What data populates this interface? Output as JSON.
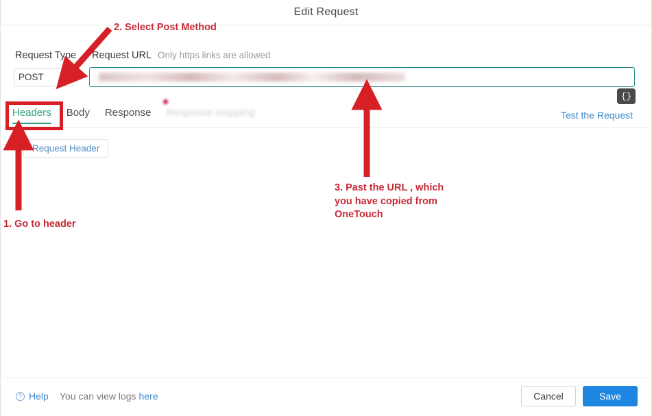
{
  "window": {
    "title": "Edit Request"
  },
  "form": {
    "request_type_label": "Request Type",
    "request_url_label": "Request URL",
    "https_hint": "Only https links are allowed",
    "request_type_value": "POST",
    "request_type_options": [
      "POST"
    ],
    "url_value": "",
    "url_placeholder": "",
    "url_redacted": true,
    "json_badge_label": "{}"
  },
  "tabs": [
    {
      "label": "Headers",
      "state": "active"
    },
    {
      "label": "Body",
      "state": "normal"
    },
    {
      "label": "Response",
      "state": "normal"
    },
    {
      "label": "Response mapping",
      "state": "disabled",
      "badge_dot": true
    }
  ],
  "actions": {
    "test_request_label": "Test the Request",
    "request_header_label": "Request Header"
  },
  "footer": {
    "help_icon": "question-circle-icon",
    "help_label": "Help",
    "logs_text_before": "You can view logs ",
    "logs_link_label": "here",
    "cancel_label": "Cancel",
    "save_label": "Save"
  },
  "annotations": [
    {
      "id": 1,
      "text": "1. Go to header"
    },
    {
      "id": 2,
      "text": "2. Select Post Method"
    },
    {
      "id": 3,
      "text": "3. Past the URL , which\nyou have copied from\nOneTouch"
    }
  ],
  "colors": {
    "accent_green": "#2fa17a",
    "link_blue": "#3f87c7",
    "save_blue": "#1e86e0",
    "annotation_red": "#c62a38",
    "highlight_box_red": "#d71f26",
    "badge_dot": "#c7124b",
    "input_border_teal": "#2c8b86"
  }
}
